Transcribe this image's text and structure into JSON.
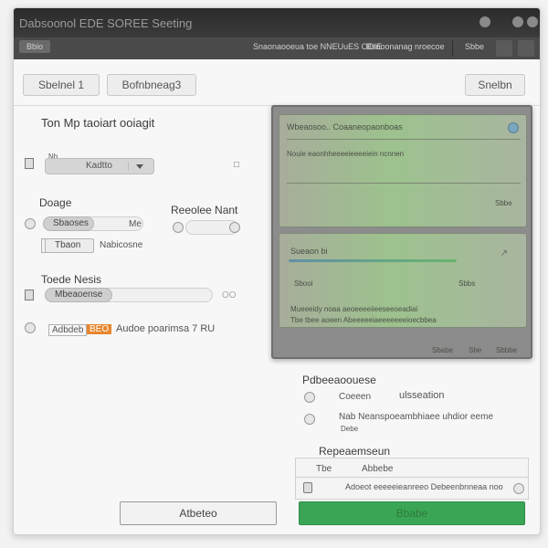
{
  "window": {
    "title": "Dabsoonol EDE SOREE Seeting"
  },
  "menubar": {
    "first_item": "Bbio",
    "items": [
      "Snaonaooeua toe NNEUuES OOIE",
      "Bsnoonanag nroecoe",
      "Sbbe"
    ]
  },
  "toolbar": {
    "tab1_label": "Sbelnel 1",
    "tab2_label": "Bofnbneag3",
    "search_label": "Snelbn"
  },
  "left": {
    "section_title": "Ton Mp taoiart ooiagit",
    "dropdown_prefix": "Nb",
    "dropdown_value": "Kadtto",
    "group1_title": "Doage",
    "pill1_label": "Sbaoses",
    "pill1_suffix": "Me",
    "box_label": "Tbaon",
    "box_suffix": "Nabicosne",
    "right_label": "Reeolee Nant",
    "group2_title": "Toede Nesis",
    "pill2_label": "Mbeaoense",
    "pill2_suffix": "OO",
    "orange_prefix": "Adbdeb",
    "orange_tag": "BEO",
    "orange_text": "Audoe poarimsa 7 RU"
  },
  "preview": {
    "header": "Wbeaosoo.. Coaaneopaonboas",
    "line1": "Nouie eaonhheeeeieeeeiein ncnnen",
    "line2_right": "Sbbe",
    "panel2_title": "Sueaon bi",
    "row1": "Sbooi",
    "row1_right": "Sbbs",
    "row2": "Mueeeidy noaa aeoeeeeiieeseeoeadiai",
    "row3": "Tbe tbee aoeen Abeeeeeiaeeeeeeeioecbbea",
    "foot1": "Sbabe",
    "foot2": "Sbe",
    "foot3": "Sbbbe"
  },
  "list": {
    "title": "Pdbeeaoouese",
    "item1_prefix": "Coeeen",
    "item1_text": "ulsseation",
    "item2_text": "Nab Neanspoeambhiaee uhdior eeme",
    "item2_sub": "Debe",
    "section_label": "Repeaemseun",
    "table_col1": "Tbe",
    "table_col2": "Abbebe",
    "table_row": "Adoeot eeeeeieanreeo Debeenbnneaa noo"
  },
  "buttons": {
    "secondary": "Atbeteo",
    "primary": "Bbabe"
  },
  "colors": {
    "primary_green": "#3aa655",
    "orange_tag": "#e8862e",
    "titlebar": "#333333"
  }
}
